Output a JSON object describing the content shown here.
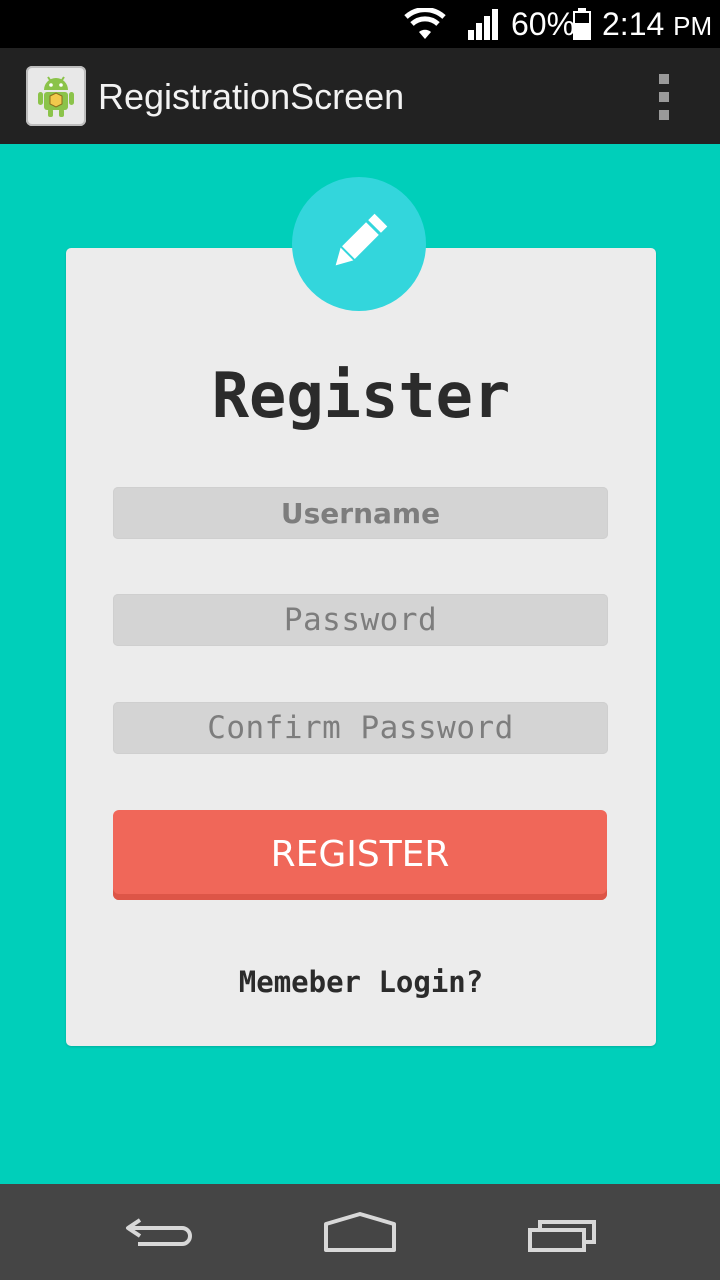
{
  "status_bar": {
    "battery": "60%",
    "time": "2:14",
    "ampm": "PM",
    "icons": [
      "wifi-icon",
      "signal-icon",
      "battery-icon"
    ]
  },
  "action_bar": {
    "title": "RegistrationScreen",
    "app_icon": "android-app-icon",
    "menu_icon": "overflow-menu-icon"
  },
  "card": {
    "badge_icon": "pencil-icon",
    "title": "Register",
    "username_placeholder": "Username",
    "password_placeholder": "Password",
    "confirm_placeholder": "Confirm Password",
    "register_label": "REGISTER",
    "login_link": "Memeber Login?"
  },
  "nav_bar": {
    "icons": [
      "back-icon",
      "home-icon",
      "recents-icon"
    ]
  },
  "colors": {
    "background": "#00CFBA",
    "badge": "#33D6DC",
    "button": "#F06759",
    "action_bar": "#222222",
    "nav_bar": "#454545"
  }
}
